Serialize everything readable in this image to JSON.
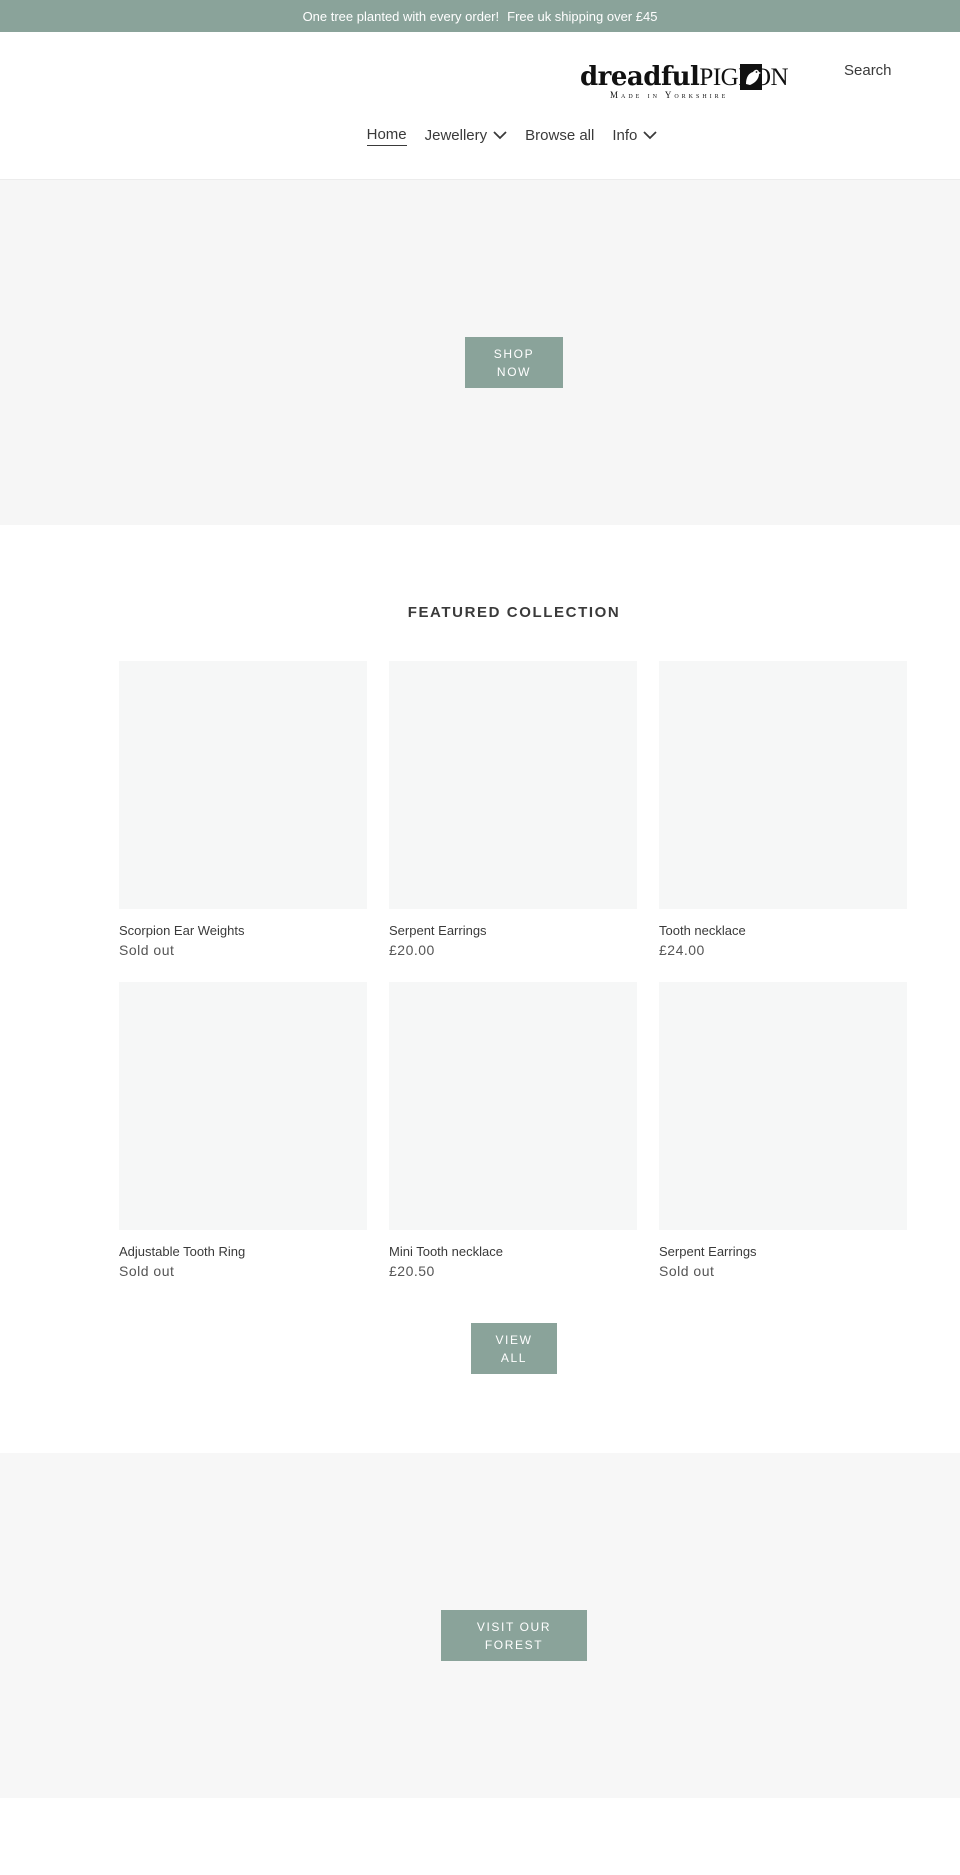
{
  "announcement": {
    "part1": "One tree planted with every order!",
    "part2": "Free uk shipping over £45"
  },
  "header": {
    "logo": {
      "word1": "dreadful",
      "word2": "PIGEON",
      "tagline": "Made in Yorkshire",
      "bird_icon": "pigeon-icon"
    },
    "search_label": "Search"
  },
  "nav": {
    "items": [
      {
        "label": "Home",
        "active": true
      },
      {
        "label": "Jewellery",
        "dropdown": true
      },
      {
        "label": "Browse all"
      },
      {
        "label": "Info",
        "dropdown": true
      }
    ]
  },
  "hero": {
    "button_label": "Shop Now"
  },
  "featured": {
    "title": "FEATURED COLLECTION",
    "products": [
      {
        "title": "Scorpion Ear Weights",
        "price": "Sold out"
      },
      {
        "title": "Serpent Earrings",
        "price": "£20.00"
      },
      {
        "title": "Tooth necklace",
        "price": "£24.00"
      },
      {
        "title": "Adjustable Tooth Ring",
        "price": "Sold out"
      },
      {
        "title": "Mini Tooth necklace",
        "price": "£20.50"
      },
      {
        "title": "Serpent Earrings",
        "price": "Sold out"
      }
    ],
    "view_all_label": "View All"
  },
  "forest": {
    "button_label": "Visit our forest"
  },
  "colors": {
    "accent": "#8aa39a",
    "placeholder": "#f6f7f7",
    "text": "#3a3a3a"
  }
}
